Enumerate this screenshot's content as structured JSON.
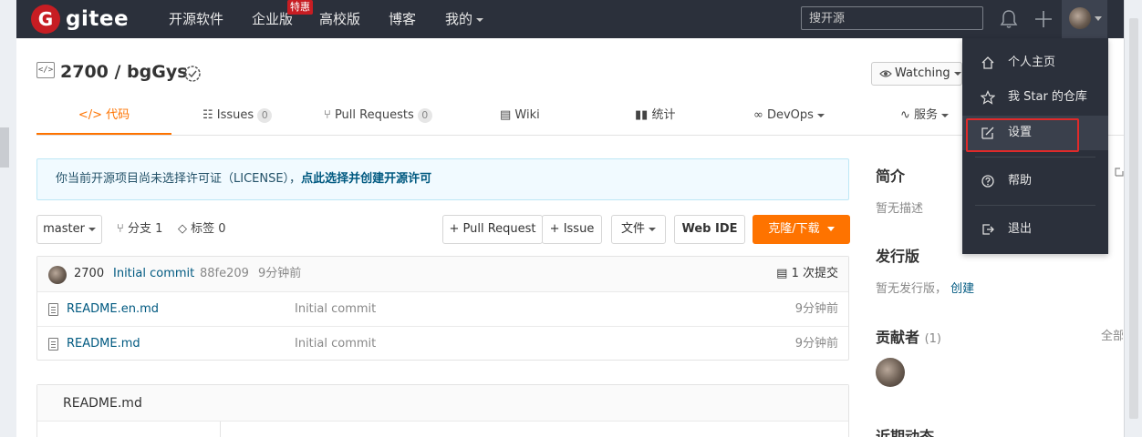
{
  "nav": {
    "logo_letter": "G",
    "logo_text": "gitee",
    "items": [
      {
        "label": "开源软件"
      },
      {
        "label": "企业版",
        "badge": "特惠"
      },
      {
        "label": "高校版"
      },
      {
        "label": "博客"
      },
      {
        "label": "我的"
      }
    ],
    "search_placeholder": "搜开源"
  },
  "repo": {
    "title": "2700 / bgGys",
    "icon_text": "</>",
    "watch_label": "Watching"
  },
  "tabs": [
    {
      "label": "</> 代码",
      "active": true
    },
    {
      "label": "Issues",
      "count": "0"
    },
    {
      "label": "Pull Requests",
      "count": "0"
    },
    {
      "label": "Wiki"
    },
    {
      "label": "统计"
    },
    {
      "label": "DevOps"
    },
    {
      "label": "服务"
    }
  ],
  "notice": {
    "text": "你当前开源项目尚未选择许可证（LICENSE），",
    "link": "点此选择并创建开源许可"
  },
  "toolbar": {
    "branch": "master",
    "branches": "分支 1",
    "tags": "标签 0",
    "pull_request": "+ Pull Request",
    "issue": "+ Issue",
    "file": "文件",
    "web_ide": "Web IDE",
    "clone": "克隆/下载"
  },
  "commit": {
    "author": "2700",
    "message": "Initial commit",
    "hash": "88fe209",
    "time": "9分钟前",
    "count": "1 次提交"
  },
  "files": [
    {
      "name": "README.en.md",
      "message": "Initial commit",
      "time": "9分钟前"
    },
    {
      "name": "README.md",
      "message": "Initial commit",
      "time": "9分钟前"
    }
  ],
  "readme": {
    "title": "README.md"
  },
  "sidebar": {
    "intro_title": "简介",
    "intro_text": "暂无描述",
    "release_title": "发行版",
    "release_text": "暂无发行版，",
    "release_link": "创建",
    "contrib_title": "贡献者",
    "contrib_count": "(1)",
    "contrib_all": "全部",
    "activity_title": "近期动态"
  },
  "dropdown": {
    "items": [
      {
        "label": "个人主页",
        "icon": "home-icon"
      },
      {
        "label": "我 Star 的仓库",
        "icon": "star-icon"
      },
      {
        "label": "设置",
        "icon": "edit-icon"
      },
      {
        "label": "帮助",
        "icon": "help-icon"
      },
      {
        "label": "退出",
        "icon": "logout-icon"
      }
    ]
  },
  "colors": {
    "navbar": "#2b303b",
    "brand_red": "#c71d23",
    "accent_orange": "#fe7300",
    "link_blue": "#005980",
    "highlight_box": "#e02a2a"
  }
}
